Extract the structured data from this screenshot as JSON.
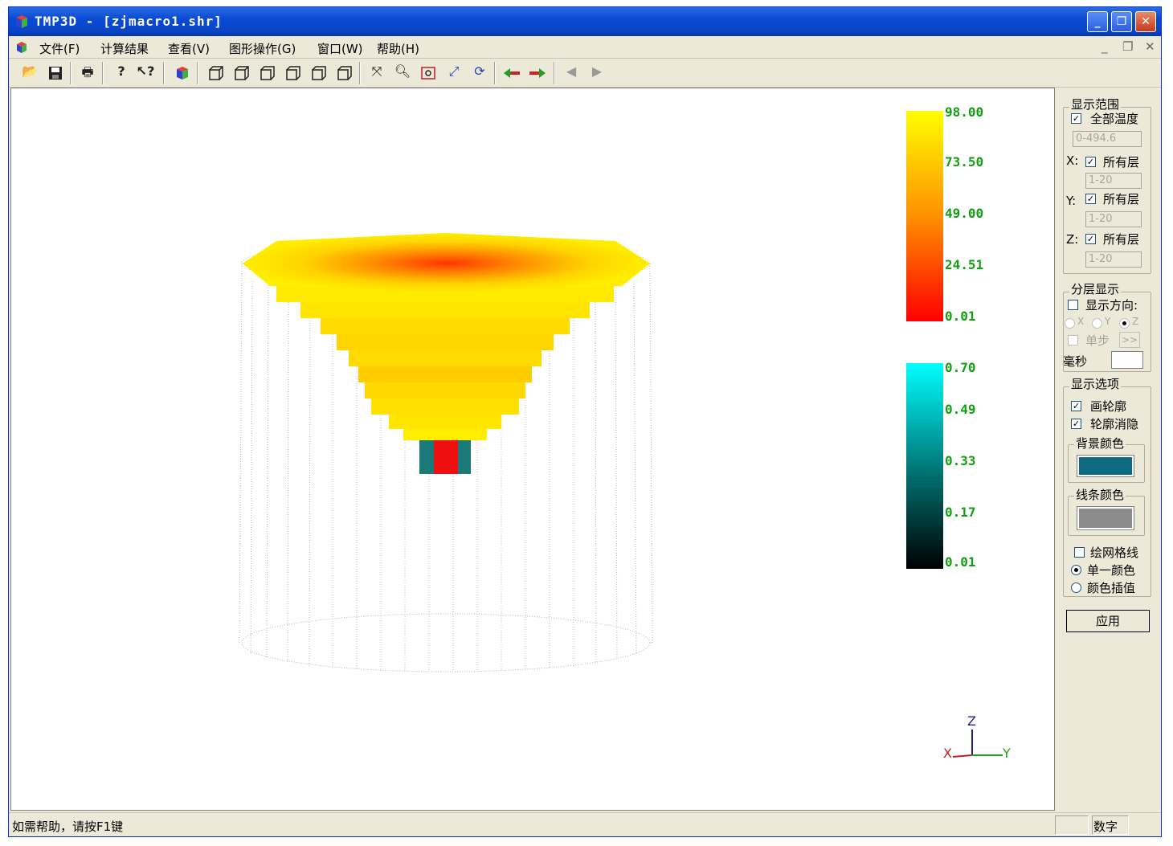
{
  "window": {
    "title": "TMP3D - [zjmacro1.shr]",
    "minimize_label": "_",
    "restore_label": "❐",
    "close_label": "✕"
  },
  "menu": {
    "items": [
      "文件(F)",
      "计算结果",
      "查看(V)",
      "图形操作(G)",
      "窗口(W)",
      "帮助(H)"
    ],
    "mdi_minimize": "_",
    "mdi_restore": "❐",
    "mdi_close": "✕"
  },
  "toolbar": {
    "icons": [
      "open-icon",
      "save-icon",
      "print-icon",
      "help-icon",
      "context-help-icon",
      "cube-icon",
      "view-front-icon",
      "view-back-icon",
      "view-left-icon",
      "view-right-icon",
      "view-top-icon",
      "view-bottom-icon",
      "fit-icon",
      "zoom-icon",
      "zoom-window-icon",
      "pan-icon",
      "rotate-icon",
      "arrow-left-icon",
      "arrow-right-icon",
      "prev-icon",
      "next-icon"
    ]
  },
  "legend_temperature": {
    "labels": [
      "98.00",
      "73.50",
      "49.00",
      "24.51",
      "0.01"
    ],
    "colors": [
      "#ffff00",
      "#ff0000"
    ]
  },
  "legend_secondary": {
    "labels": [
      "0.70",
      "0.49",
      "0.33",
      "0.17",
      "0.01"
    ],
    "colors": [
      "#00ffff",
      "#000000"
    ]
  },
  "axes": {
    "z": "Z",
    "x": "X",
    "y": "Y"
  },
  "panel": {
    "range": {
      "title": "显示范围",
      "all_temp_label": "全部温度",
      "all_temp_checked": true,
      "temp_range": "0-494.6",
      "x_label": "X:",
      "y_label": "Y:",
      "z_label": "Z:",
      "all_layers_label": "所有层",
      "x_range": "1-20",
      "y_range": "1-20",
      "z_range": "1-20"
    },
    "layer": {
      "title": "分层显示",
      "direction_label": "显示方向:",
      "x_opt": "X",
      "y_opt": "Y",
      "z_opt": "Z",
      "step_label": "单步",
      "step_button": ">>",
      "ms_label": "毫秒"
    },
    "options": {
      "title": "显示选项",
      "outline_label": "画轮廓",
      "hidden_label": "轮廓消隐",
      "bg_color_title": "背景颜色",
      "bg_color": "#0e6a80",
      "line_color_title": "线条颜色",
      "line_color": "#8c8c8c",
      "grid_label": "绘网格线",
      "single_color_label": "单一颜色",
      "interp_label": "颜色插值"
    },
    "apply_label": "应用"
  },
  "status": {
    "hint": "如需帮助，请按F1键",
    "num": "数字"
  }
}
